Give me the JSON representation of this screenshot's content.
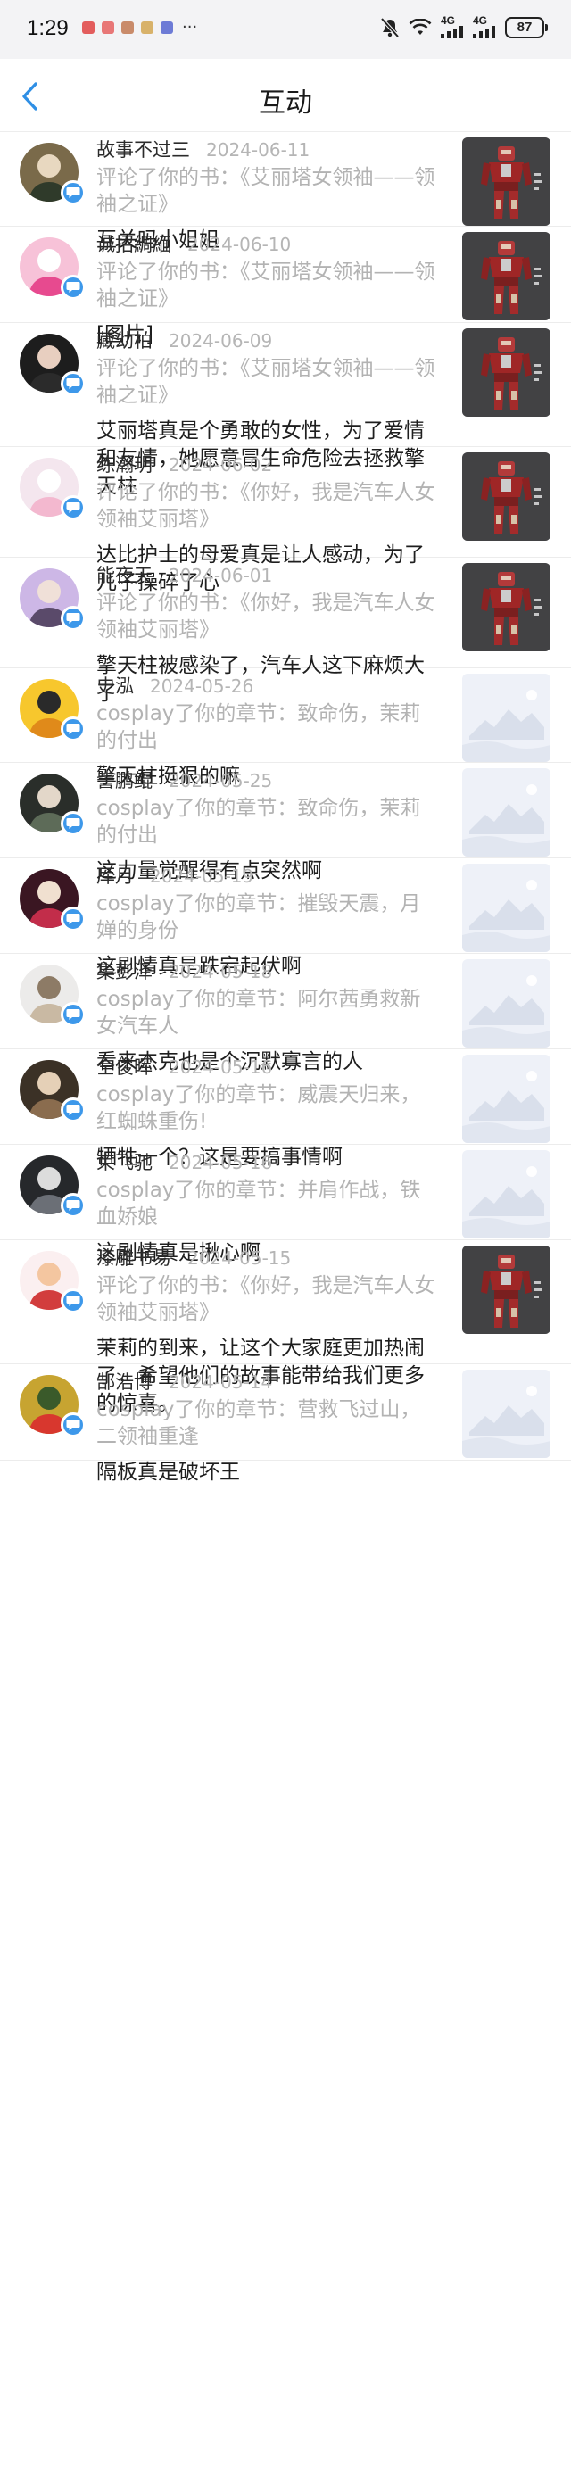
{
  "status_bar": {
    "time": "1:29",
    "more": "···",
    "network_a": "4G",
    "network_b": "4G",
    "battery": "87"
  },
  "header": {
    "title": "互动"
  },
  "items": [
    {
      "user": "故事不过三",
      "date": "2024-06-11",
      "action": "评论了你的书：《艾丽塔女领袖——领袖之证》",
      "content": "互关吗小姐姐",
      "thumb": "robot",
      "avatar": "av0"
    },
    {
      "user": "诚招綢緬",
      "date": "2024-06-10",
      "action": "评论了你的书：《艾丽塔女领袖——领袖之证》",
      "content": "[图片]",
      "thumb": "robot",
      "avatar": "av1"
    },
    {
      "user": "藏幼柏",
      "date": "2024-06-09",
      "action": "评论了你的书：《艾丽塔女领袖——领袖之证》",
      "content": "艾丽塔真是个勇敢的女性，为了爱情和友情，她愿意冒生命危险去拯救擎天柱",
      "thumb": "robot",
      "avatar": "av2"
    },
    {
      "user": "练瀚玥",
      "date": "2024-06-02",
      "action": "评论了你的书：《你好，我是汽车人女领袖艾丽塔》",
      "content": "达比护士的母爱真是让人感动，为了儿子操碎了心",
      "thumb": "robot",
      "avatar": "av3"
    },
    {
      "user": "能夜天",
      "date": "2024-06-01",
      "action": "评论了你的书：《你好，我是汽车人女领袖艾丽塔》",
      "content": "擎天柱被感染了，汽车人这下麻烦大了",
      "thumb": "robot",
      "avatar": "av4"
    },
    {
      "user": "史泓",
      "date": "2024-05-26",
      "action": "cosplay了你的章节：致命伤，茉莉的付出",
      "content": "擎天柱挺狠的嘛",
      "thumb": "placeholder",
      "avatar": "av5"
    },
    {
      "user": "訾鹏鲲",
      "date": "2024-05-25",
      "action": "cosplay了你的章节：致命伤，茉莉的付出",
      "content": "这力量觉醒得有点突然啊",
      "thumb": "placeholder",
      "avatar": "av6"
    },
    {
      "user": "厍月",
      "date": "2024-05-19",
      "action": "cosplay了你的章节：摧毁天震，月婵的身份",
      "content": "这剧情真是跌宕起伏啊",
      "thumb": "placeholder",
      "avatar": "av7"
    },
    {
      "user": "集彭泽",
      "date": "2024-05-18",
      "action": "cosplay了你的章节：阿尔茜勇救新女汽车人",
      "content": "看来杰克也是个沉默寡言的人",
      "thumb": "placeholder",
      "avatar": "av8"
    },
    {
      "user": "仝俊晖",
      "date": "2024-05-16",
      "action": "cosplay了你的章节：威震天归来，红蜘蛛重伤!",
      "content": "牺牲一个？这是要搞事情啊",
      "thumb": "placeholder",
      "avatar": "av9"
    },
    {
      "user": "束飞驰",
      "date": "2024-05-16",
      "action": "cosplay了你的章节：并肩作战，铁血娇娘",
      "content": "这剧情真是揪心啊",
      "thumb": "placeholder",
      "avatar": "av10"
    },
    {
      "user": "漆雕书易",
      "date": "2024-05-15",
      "action": "评论了你的书：《你好，我是汽车人女领袖艾丽塔》",
      "content": "茉莉的到来，让这个大家庭更加热闹了，希望他们的故事能带给我们更多的惊喜。",
      "thumb": "robot",
      "avatar": "av11"
    },
    {
      "user": "郜浩博",
      "date": "2024-05-14",
      "action": "cosplay了你的章节：营救飞过山，二领袖重逢",
      "content": "隔板真是破坏王",
      "thumb": "placeholder",
      "avatar": "av12"
    }
  ],
  "colors": {
    "accent": "#3d98ea",
    "muted_text": "#b3b3b3",
    "divider": "#ececec"
  },
  "icons": {
    "back": "chevron-left-icon",
    "badge": "chat-bubble-icon",
    "mute": "bell-off-icon",
    "wifi": "wifi-icon",
    "signal": "signal-icon",
    "battery": "battery-icon"
  }
}
